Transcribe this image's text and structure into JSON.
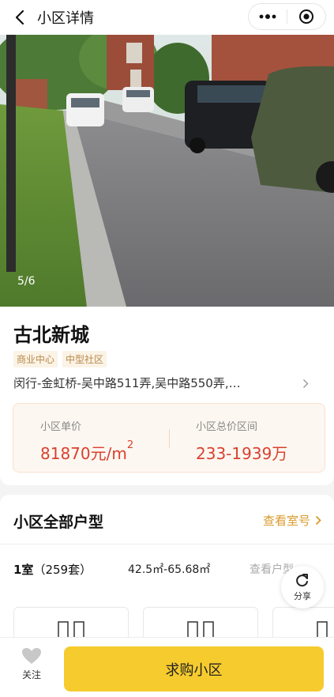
{
  "header": {
    "title": "小区详情",
    "icons": [
      "back-arrow-icon",
      "more-dots-icon",
      "target-close-icon"
    ]
  },
  "gallery": {
    "counter": "5/6"
  },
  "estate": {
    "name": "古北新城",
    "tags": [
      "商业中心",
      "中型社区"
    ],
    "address": "闵行-金虹桥-吴中路511弄,吴中路550弄,…"
  },
  "price": {
    "unit_label": "小区单价",
    "unit_value": "81870元/m",
    "unit_sup": "2",
    "total_label": "小区总价区间",
    "total_value": "233-1939万"
  },
  "layouts": {
    "title": "小区全部户型",
    "link": "查看室号",
    "rooms": [
      {
        "name": "1室",
        "count": "（259套）",
        "area": "42.5㎡-65.68㎡",
        "view": "查看户型"
      }
    ]
  },
  "share": {
    "label": "分享"
  },
  "bottom": {
    "fav_label": "关注",
    "buy_label": "求购小区"
  },
  "colors": {
    "accent": "#f6cb2d",
    "price": "#d9412f",
    "link": "#d99a2b",
    "tag_text": "#b8884a"
  }
}
